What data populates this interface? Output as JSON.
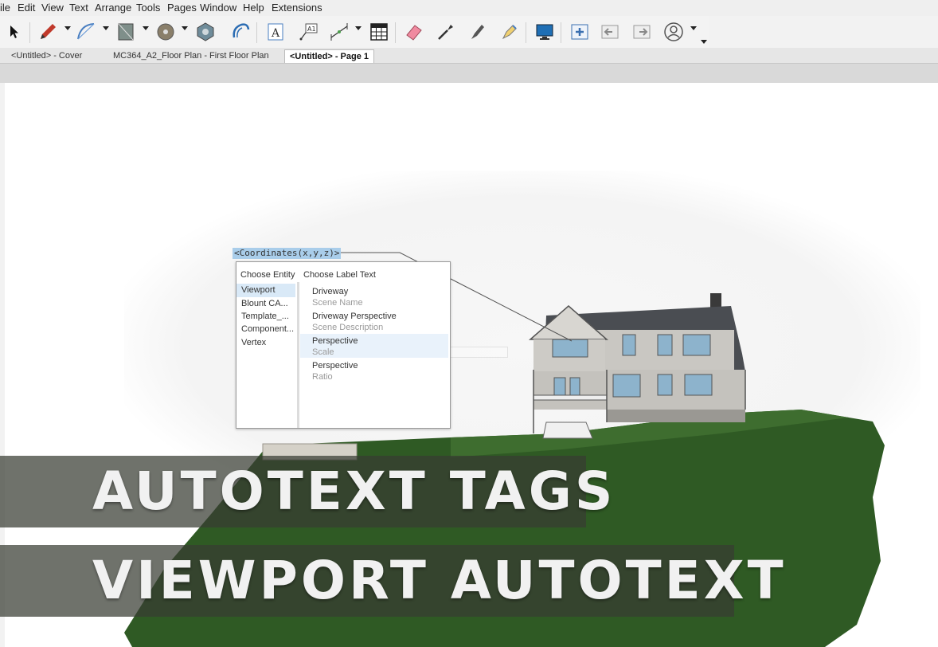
{
  "menu": [
    "ile",
    "Edit",
    "View",
    "Text",
    "Arrange",
    "Tools",
    "Pages",
    "Window",
    "Help",
    "Extensions"
  ],
  "tabs": [
    {
      "label": "<Untitled> - Cover",
      "active": false
    },
    {
      "label": "MC364_A2_Floor Plan - First Floor Plan",
      "active": false
    },
    {
      "label": "<Untitled> - Page 1",
      "active": true
    }
  ],
  "autotext_tag": "<Coordinates(x,y,z)>",
  "dialog": {
    "entity_header": "Choose Entity",
    "label_header": "Choose Label Text",
    "entities": [
      "Viewport",
      "Blount CA...",
      "Template_...",
      "Component...",
      "Vertex"
    ],
    "label_items": [
      {
        "main": "Driveway",
        "sub": "Scene Name"
      },
      {
        "main": "Driveway Perspective",
        "sub": "Scene Description"
      },
      {
        "main": "Perspective",
        "sub": "Scale"
      },
      {
        "main": "Perspective",
        "sub": "Ratio"
      }
    ]
  },
  "overlay": {
    "line1": "AUTOTEXT TAGS",
    "line2": "VIEWPORT AUTOTEXT"
  },
  "colors": {
    "tag_highlight": "#a9cdea",
    "selected_entity": "#d9e9f7",
    "lawn": "#2f5a24",
    "roof": "#4a4d52"
  }
}
